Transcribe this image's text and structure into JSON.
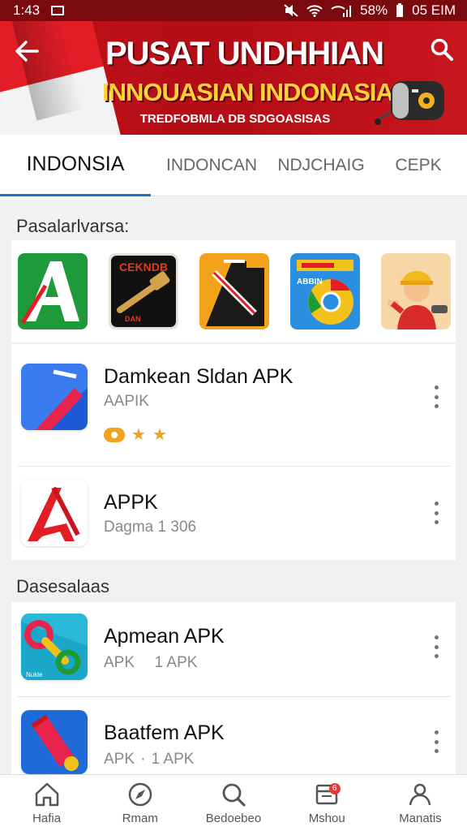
{
  "status_bar": {
    "time": "1:43",
    "battery": "58%",
    "clock_right": "05 EIM"
  },
  "banner": {
    "title": "PUSAT UNDHHIAN",
    "subtitle": "INNOUASIAN INDONASIA",
    "tagline": "TREDFOBMLA DB SDGOASISAS"
  },
  "tabs": [
    {
      "label": "INDONSIA",
      "active": true
    },
    {
      "label": "INDONCAN",
      "active": false
    },
    {
      "label": "NDJCHAIG",
      "active": false
    },
    {
      "label": "CEPK",
      "active": false
    }
  ],
  "featured": {
    "title": "Pasalarlvarsa:",
    "items": [
      {
        "icon": "green-a-logo-icon"
      },
      {
        "icon": "black-hammer-game-icon",
        "text_top": "CEKNDB",
        "text_bottom": "DAN"
      },
      {
        "icon": "orange-black-app-icon"
      },
      {
        "icon": "blue-chrome-like-icon",
        "text": "ABBIN"
      },
      {
        "icon": "worker-character-icon"
      }
    ]
  },
  "list1": [
    {
      "name": "Damkean Sldan APK",
      "meta": "AAPIK",
      "rating_stars": 2,
      "icon": "red-blue-wing-icon"
    },
    {
      "name": "APPK",
      "meta": "Dagma 1 306",
      "icon": "red-a-icon"
    }
  ],
  "section2": {
    "title": "Dasesalaas"
  },
  "list2": [
    {
      "name": "Apmean APK",
      "meta_a": "APK",
      "meta_b": "1 APK",
      "icon": "colorful-wrench-icon"
    },
    {
      "name": "Baatfem APK",
      "meta_a": "APK",
      "meta_b": "1 APK",
      "icon": "red-pencil-icon"
    }
  ],
  "bottom_nav": [
    {
      "label": "Hafia",
      "icon": "home-icon"
    },
    {
      "label": "Rmam",
      "icon": "compass-icon"
    },
    {
      "label": "Bedoebeo",
      "icon": "search-icon"
    },
    {
      "label": "Mshou",
      "icon": "inbox-icon",
      "badge": "6"
    },
    {
      "label": "Manatis",
      "icon": "person-icon"
    }
  ],
  "colors": {
    "banner_red": "#c3121b",
    "status_bar": "#7a0a0e",
    "tab_indicator": "#1a73c6",
    "star": "#f0a31b"
  }
}
